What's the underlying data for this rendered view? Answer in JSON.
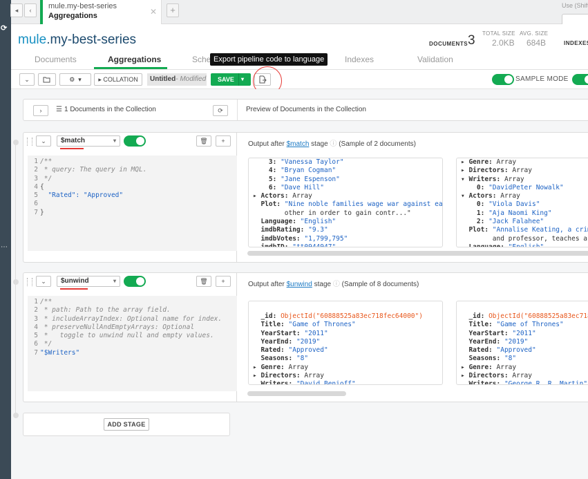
{
  "tab": {
    "db_collection": "mule.my-best-series",
    "subtitle": "Aggregations"
  },
  "search_hint": "Use (Shift+) E",
  "header": {
    "db": "mule",
    "collection": ".my-best-series",
    "documents_label": "DOCUMENTS",
    "documents_count": "3",
    "total_size_label": "TOTAL SIZE",
    "total_size_value": "2.0KB",
    "avg_size_label": "AVG. SIZE",
    "avg_size_value": "684B",
    "indexes_label": "INDEXES"
  },
  "subtabs": [
    "Documents",
    "Aggregations",
    "Sche",
    "Indexes",
    "Validation"
  ],
  "tooltip": "Export pipeline code to language",
  "toolbar": {
    "collation_label": "COLLATION",
    "pipeline_name": "Untitled",
    "modified_label": "- Modified",
    "save_label": "SAVE",
    "sample_mode_label": "SAMPLE MODE"
  },
  "summary": {
    "count_text": "1 Documents in the Collection",
    "preview_text": "Preview of Documents in the Collection"
  },
  "stages": [
    {
      "operator": "$match",
      "output_prefix": "Output after",
      "output_stage": "$match",
      "output_suffix": "stage",
      "sample_text": "(Sample of 2 documents)",
      "code": [
        {
          "n": "1",
          "t": "/**",
          "c": "cm"
        },
        {
          "n": "2",
          "t": " * query: The query in MQL.",
          "c": "cm"
        },
        {
          "n": "3",
          "t": " */",
          "c": "cm"
        },
        {
          "n": "4",
          "t": "{",
          "c": ""
        },
        {
          "n": "5",
          "t": "  \"Rated\": \"Approved\"",
          "c": "str"
        },
        {
          "n": "6",
          "t": "",
          "c": ""
        },
        {
          "n": "7",
          "t": "}",
          "c": ""
        }
      ],
      "docs": [
        [
          "    3: \"Vanessa Taylor\"",
          "    4: \"Bryan Cogman\"",
          "    5: \"Jane Espenson\"",
          "    6: \"Dave Hill\"",
          "▸ Actors: Array",
          "  Plot: \"Nine noble families wage war against each",
          "        other in order to gain contr...\"",
          "  Language: \"English\"",
          "  imdbRating: \"9.3\"",
          "  imdbVotes: \"1,799,795\"",
          "  imdbID: \"tt0944947\""
        ],
        [
          "▸ Genre: Array",
          "▸ Directors: Array",
          "▾ Writers: Array",
          "    0: \"DavidPeter Nowalk\"",
          "▾ Actors: Array",
          "    0: \"Viola Davis\"",
          "    1: \"Aja Naomi King\"",
          "    2: \"Jack Falahee\"",
          "  Plot: \"Annalise Keating, a crimin",
          "        and professor, teaches a g...",
          "  Language: \"English\""
        ]
      ]
    },
    {
      "operator": "$unwind",
      "output_prefix": "Output after",
      "output_stage": "$unwind",
      "output_suffix": "stage",
      "sample_text": "(Sample of 8 documents)",
      "code": [
        {
          "n": "1",
          "t": "/**",
          "c": "cm"
        },
        {
          "n": "2",
          "t": " * path: Path to the array field.",
          "c": "cm"
        },
        {
          "n": "3",
          "t": " * includeArrayIndex: Optional name for index.",
          "c": "cm"
        },
        {
          "n": "4",
          "t": " * preserveNullAndEmptyArrays: Optional",
          "c": "cm"
        },
        {
          "n": "5",
          "t": " *   toggle to unwind null and empty values.",
          "c": "cm"
        },
        {
          "n": "6",
          "t": " */",
          "c": "cm"
        },
        {
          "n": "7",
          "t": "\"$Writers\"",
          "c": "str"
        }
      ],
      "docs": [
        [
          "  _id: ObjectId(\"60888525a83ec718fec64000\")",
          "  Title: \"Game of Thrones\"",
          "  YearStart: \"2011\"",
          "  YearEnd: \"2019\"",
          "  Rated: \"Approved\"",
          "  Seasons: \"8\"",
          "▸ Genre: Array",
          "▸ Directors: Array",
          "  Writers: \"David Benioff\""
        ],
        [
          "  _id: ObjectId(\"60888525a83ec718f",
          "  Title: \"Game of Thrones\"",
          "  YearStart: \"2011\"",
          "  YearEnd: \"2019\"",
          "  Rated: \"Approved\"",
          "  Seasons: \"8\"",
          "▸ Genre: Array",
          "▸ Directors: Array",
          "  Writers: \"George R. R. Martin\""
        ]
      ]
    }
  ],
  "add_stage_label": "ADD STAGE",
  "colors": {
    "accent": "#13aa52",
    "annotation": "#e53935"
  }
}
